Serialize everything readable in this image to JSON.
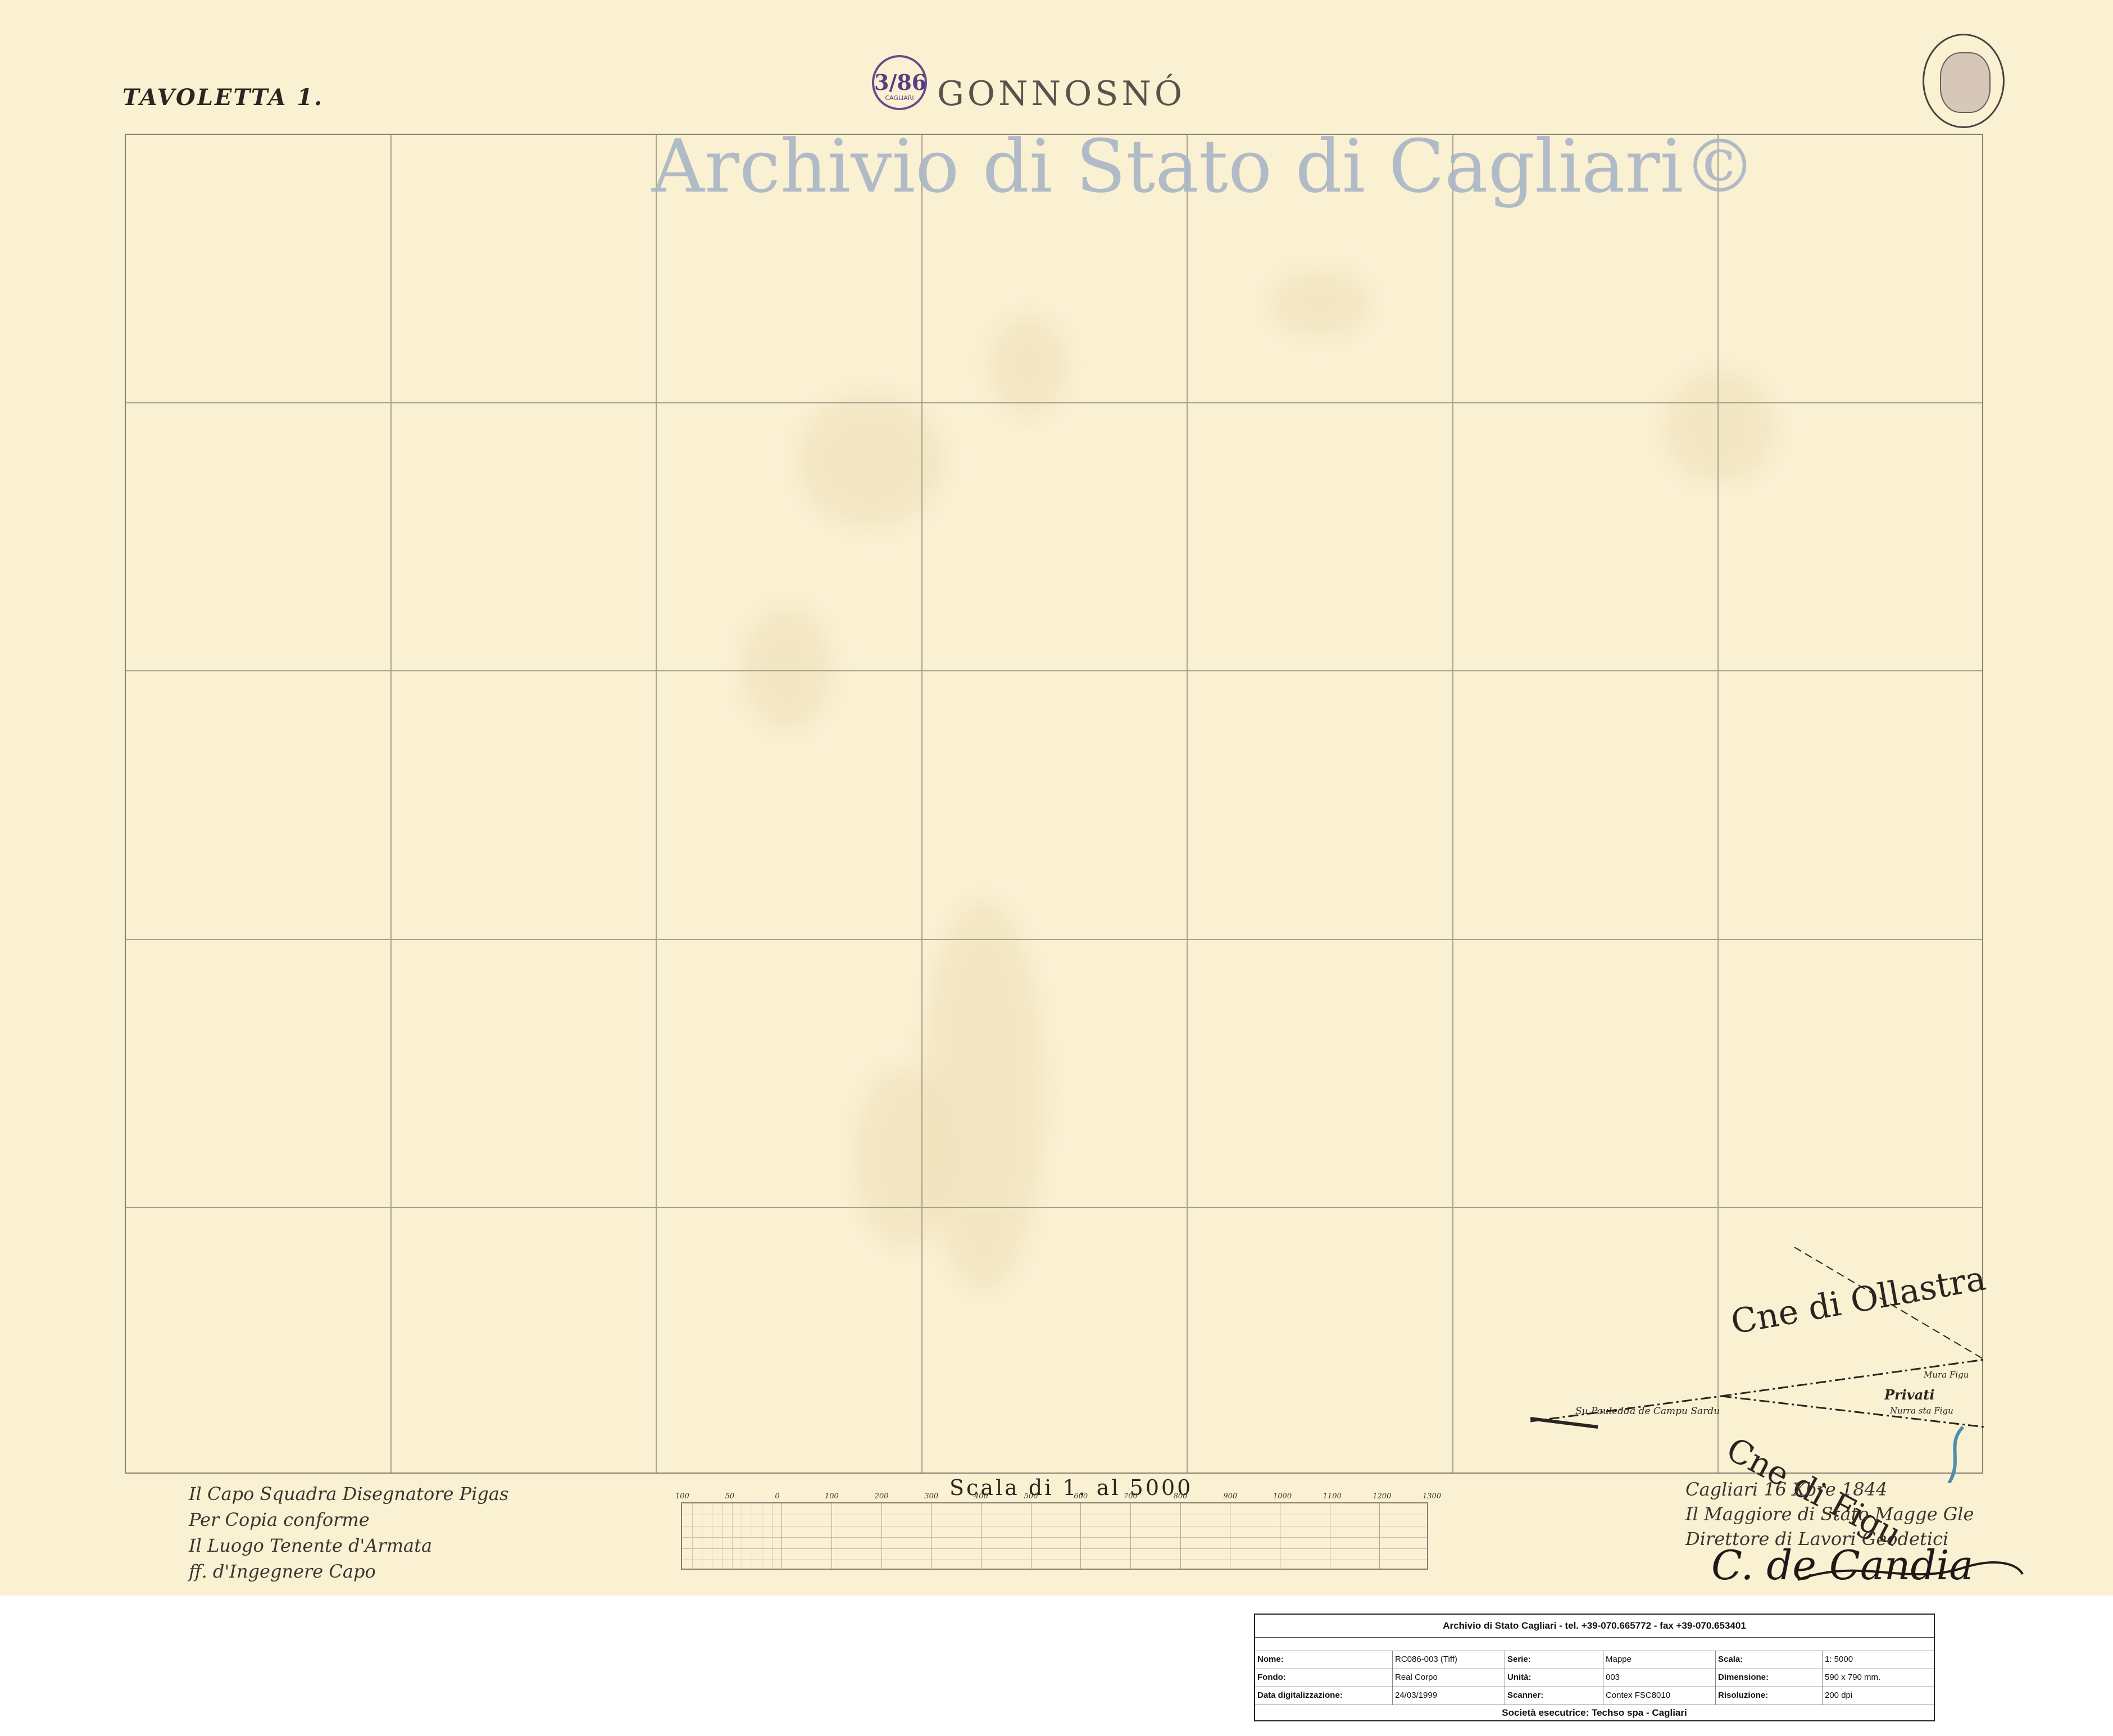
{
  "sheet": {
    "label": "TAVOLETTA 1.",
    "title": "GONNOSNÓ",
    "watermark": "Archivio di Stato di Cagliari©",
    "stamp_left": {
      "number": "3/86",
      "ring_text": "CAGLIARI"
    },
    "stamp_right": {
      "icon": "archive-seal-icon"
    }
  },
  "map": {
    "grid": {
      "columns": 7,
      "rows": 5
    },
    "places": {
      "ollastra": "Cne di Ollastra",
      "figu": "Cne di Figu",
      "privati": "Privati",
      "pauledda": "Su Pauledda de Campu Sardu",
      "mura_figu": "Mura Figu",
      "nurra_figu": "Nurra sta Figu"
    },
    "colors": {
      "paper": "#faf0d2",
      "grid_line": "#aaa08f",
      "watermark": "#a9b6c6",
      "stamp_violet": "#6a4a8a",
      "river": "#4a8fb0"
    }
  },
  "scale": {
    "title": "Scala di 1. al 5000",
    "ticks": [
      "100",
      "50",
      "0",
      "100",
      "200",
      "300",
      "400",
      "500",
      "600",
      "700",
      "800",
      "900",
      "1000",
      "1100",
      "1200",
      "1300"
    ]
  },
  "handwriting": {
    "left": [
      "Il Capo Squadra Disegnatore Pigas",
      "Per Copia conforme",
      "Il Luogo Tenente d'Armata",
      "ff. d'Ingegnere Capo"
    ],
    "right": [
      "Cagliari 16 Xbre 1844",
      "Il Maggiore di Stato Magge Gle",
      "Direttore di Lavori Geodetici"
    ],
    "signature": "C. de Candia"
  },
  "info": {
    "header": "Archivio di Stato Cagliari - tel. +39-070.665772 - fax +39-070.653401",
    "rows": [
      [
        {
          "k": "Nome:",
          "v": "RC086-003  (Tiff)"
        },
        {
          "k": "Serie:",
          "v": "Mappe"
        },
        {
          "k": "Scala:",
          "v": "1: 5000"
        }
      ],
      [
        {
          "k": "Fondo:",
          "v": "Real Corpo"
        },
        {
          "k": "Unità:",
          "v": "003"
        },
        {
          "k": "Dimensione:",
          "v": "590 x 790 mm."
        }
      ],
      [
        {
          "k": "Data digitalizzazione:",
          "v": "24/03/1999"
        },
        {
          "k": "Scanner:",
          "v": "Contex FSC8010"
        },
        {
          "k": "Risoluzione:",
          "v": "200 dpi"
        }
      ]
    ],
    "footer": "Società esecutrice: Techso spa - Cagliari"
  }
}
